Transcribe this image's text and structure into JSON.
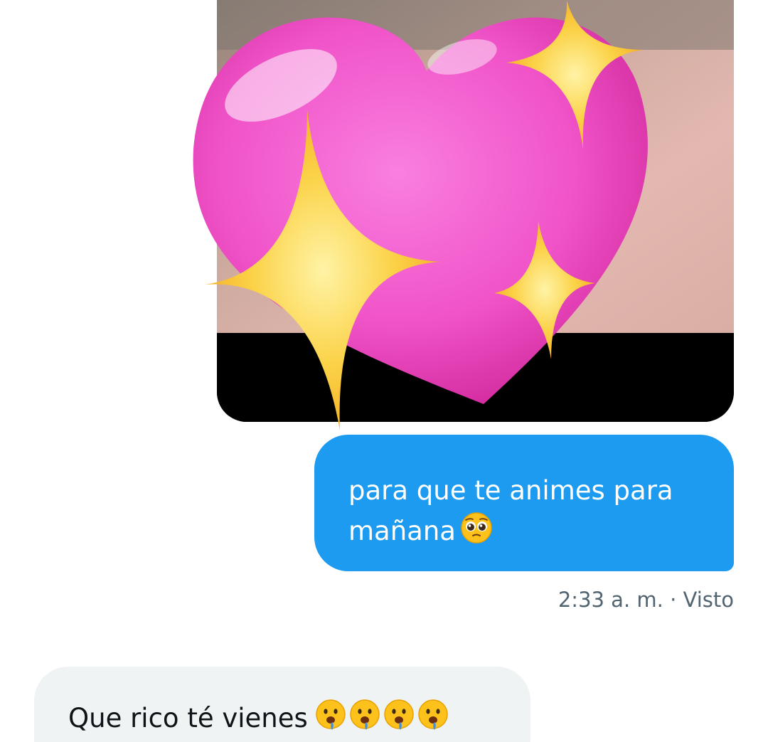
{
  "conversation": {
    "outgoing_message": {
      "text": "para que te animes para mañana",
      "line1": "para que te animes para",
      "line2": "mañana",
      "emoji": "pleading-face-icon",
      "meta": "2:33 a. m. · Visto"
    },
    "incoming_message": {
      "text": "Que rico té vienes",
      "emojis": [
        "drooling-face-icon",
        "drooling-face-icon",
        "drooling-face-icon",
        "drooling-face-icon"
      ]
    },
    "media": {
      "sticker": "sparkling-heart-icon"
    }
  },
  "colors": {
    "outgoing_bubble": "#1d9bf0",
    "incoming_bubble": "#eff3f4",
    "meta_text": "#536471",
    "heart": "#f25bd0",
    "sparkle": "#fbd247"
  }
}
